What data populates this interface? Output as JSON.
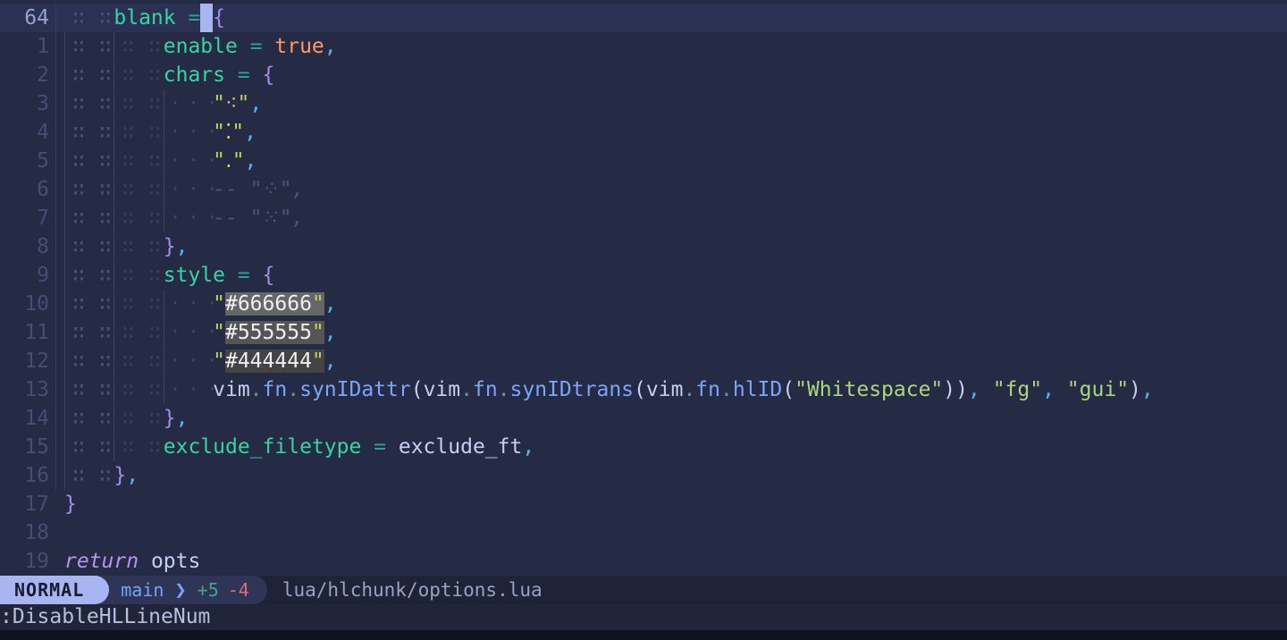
{
  "editor": {
    "lines": [
      {
        "num": "64",
        "current": true,
        "indent": [
          "d0"
        ],
        "tokens": [
          [
            "fld",
            "blank"
          ],
          [
            "op",
            " ="
          ],
          [
            "cursor",
            " "
          ],
          [
            "brace",
            "{"
          ]
        ]
      },
      {
        "num": "1",
        "indent": [
          "d",
          "gd"
        ],
        "tokens": [
          [
            "fld",
            "enable"
          ],
          [
            "op",
            " = "
          ],
          [
            "bool",
            "true"
          ],
          [
            "comma",
            ","
          ]
        ]
      },
      {
        "num": "2",
        "indent": [
          "d",
          "gd"
        ],
        "tokens": [
          [
            "fld",
            "chars"
          ],
          [
            "op",
            " = "
          ],
          [
            "brace",
            "{"
          ]
        ]
      },
      {
        "num": "3",
        "indent": [
          "d",
          "gd",
          "gl"
        ],
        "tokens": [
          [
            "strq",
            "\""
          ],
          [
            "sdot",
            "⁖"
          ],
          [
            "strq",
            "\""
          ],
          [
            "comma",
            ","
          ]
        ]
      },
      {
        "num": "4",
        "indent": [
          "d",
          "gd",
          "gl"
        ],
        "tokens": [
          [
            "strq",
            "\""
          ],
          [
            "sdot",
            "⁚"
          ],
          [
            "strq",
            "\""
          ],
          [
            "comma",
            ","
          ]
        ]
      },
      {
        "num": "5",
        "indent": [
          "d",
          "gd",
          "gl"
        ],
        "tokens": [
          [
            "strq",
            "\""
          ],
          [
            "sdot",
            "․"
          ],
          [
            "strq",
            "\""
          ],
          [
            "comma",
            ","
          ]
        ]
      },
      {
        "num": "6",
        "indent": [
          "d",
          "gd",
          "gl"
        ],
        "tokens": [
          [
            "cmt",
            "-- \"⁘\","
          ]
        ]
      },
      {
        "num": "7",
        "indent": [
          "d",
          "gd",
          "gl"
        ],
        "tokens": [
          [
            "cmt",
            "-- \"⁙\","
          ]
        ]
      },
      {
        "num": "8",
        "indent": [
          "d",
          "gd"
        ],
        "tokens": [
          [
            "brace",
            "}"
          ],
          [
            "comma",
            ","
          ]
        ]
      },
      {
        "num": "9",
        "indent": [
          "d",
          "gd"
        ],
        "tokens": [
          [
            "fld",
            "style"
          ],
          [
            "op",
            " = "
          ],
          [
            "brace",
            "{"
          ]
        ]
      },
      {
        "num": "10",
        "indent": [
          "d",
          "gd",
          "gl"
        ],
        "tokens": [
          [
            "strq",
            "\""
          ],
          [
            "hx666",
            "#666666"
          ],
          [
            "hq666",
            "\""
          ],
          [
            "comma",
            ","
          ]
        ]
      },
      {
        "num": "11",
        "indent": [
          "d",
          "gd",
          "gl"
        ],
        "tokens": [
          [
            "strq",
            "\""
          ],
          [
            "hx555",
            "#555555"
          ],
          [
            "hq555",
            "\""
          ],
          [
            "comma",
            ","
          ]
        ]
      },
      {
        "num": "12",
        "indent": [
          "d",
          "gd",
          "gl"
        ],
        "tokens": [
          [
            "strq",
            "\""
          ],
          [
            "hx444",
            "#444444"
          ],
          [
            "hq444",
            "\""
          ],
          [
            "comma",
            ","
          ]
        ]
      },
      {
        "num": "13",
        "indent": [
          "d",
          "gd",
          "gl"
        ],
        "tokens": [
          [
            "var",
            "vim"
          ],
          [
            "dot",
            "."
          ],
          [
            "fn",
            "fn"
          ],
          [
            "dot",
            "."
          ],
          [
            "fn",
            "synIDattr"
          ],
          [
            "punc",
            "("
          ],
          [
            "var",
            "vim"
          ],
          [
            "dot",
            "."
          ],
          [
            "fn",
            "fn"
          ],
          [
            "dot",
            "."
          ],
          [
            "fn",
            "synIDtrans"
          ],
          [
            "punc",
            "("
          ],
          [
            "var",
            "vim"
          ],
          [
            "dot",
            "."
          ],
          [
            "fn",
            "fn"
          ],
          [
            "dot",
            "."
          ],
          [
            "fn",
            "hlID"
          ],
          [
            "punc",
            "("
          ],
          [
            "str",
            "\"Whitespace\""
          ],
          [
            "punc",
            "))"
          ],
          [
            "comma",
            ","
          ],
          [
            "str",
            " \"fg\""
          ],
          [
            "comma",
            ","
          ],
          [
            "str",
            " \"gui\""
          ],
          [
            "punc",
            ")"
          ],
          [
            "comma",
            ","
          ]
        ]
      },
      {
        "num": "14",
        "indent": [
          "d",
          "gd"
        ],
        "tokens": [
          [
            "brace",
            "}"
          ],
          [
            "comma",
            ","
          ]
        ]
      },
      {
        "num": "15",
        "indent": [
          "d",
          "gd"
        ],
        "tokens": [
          [
            "fld",
            "exclude_filetype"
          ],
          [
            "op",
            " = "
          ],
          [
            "var",
            "exclude_ft"
          ],
          [
            "comma",
            ","
          ]
        ]
      },
      {
        "num": "16",
        "indent": [
          "d"
        ],
        "tokens": [
          [
            "brace",
            "}"
          ],
          [
            "comma",
            ","
          ]
        ]
      },
      {
        "num": "17",
        "indent": [],
        "tokens": [
          [
            "brace",
            "}"
          ]
        ]
      },
      {
        "num": "18",
        "indent": [],
        "tokens": []
      },
      {
        "num": "19",
        "indent": [],
        "tokens": [
          [
            "ret",
            "return"
          ],
          [
            "var",
            " opts"
          ]
        ]
      }
    ]
  },
  "statusline": {
    "mode": "NORMAL",
    "branch": "main",
    "chevron": "❯",
    "diff_added": "+5",
    "diff_removed": "-4",
    "file": "lua/hlchunk/options.lua"
  },
  "cmdline": {
    "text": ":DisableHLLineNum"
  },
  "colors": {
    "background": "#252b45",
    "cursorline": "#2b3152",
    "mode_pill": "#a7b5f1",
    "git_blue": "#7aa2f7",
    "diff_add_green": "#41a883",
    "diff_del_red": "#e5677e",
    "field_teal": "#37d3a2",
    "boolean_orange": "#ff9a60",
    "brace_purple": "#a18cf0",
    "string_lime": "#bed45c",
    "hex_previews": [
      "#666666",
      "#555555",
      "#444444"
    ]
  }
}
